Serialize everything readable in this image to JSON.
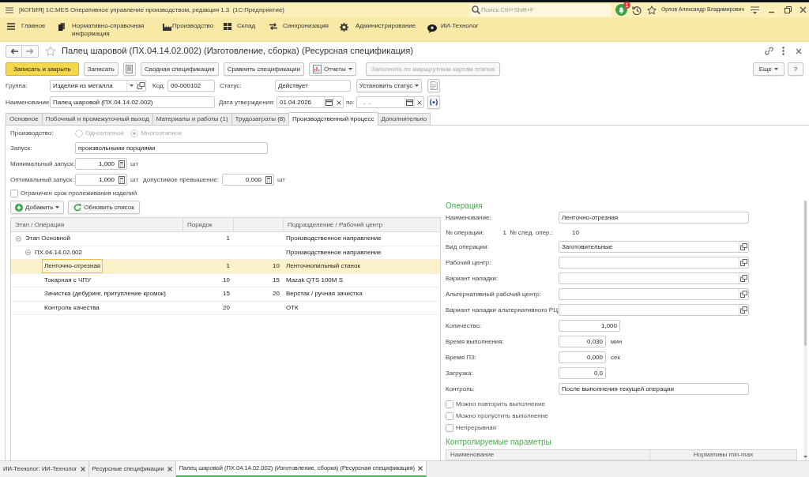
{
  "window": {
    "title": "[КОПИЯ] 1С:MES Оперативное управление производством, редакция 1.3  (1С:Предприятие)",
    "search": {
      "placeholder": "Поиск Ctrl+Shift+F"
    },
    "notifications": "1",
    "user": "Орлов Александр Владимирович"
  },
  "sections": [
    {
      "label": "Главное"
    },
    {
      "label": "Нормативно-справочная информация"
    },
    {
      "label": "Производство"
    },
    {
      "label": "Склад"
    },
    {
      "label": "Синхронизация"
    },
    {
      "label": "Администрирование"
    },
    {
      "label": "ИИ-Технолог"
    }
  ],
  "form": {
    "title": "Палец шаровой (ПХ.04.14.02.002) (Изготовление, сборка) (Ресурсная спецификация)",
    "favorite": false,
    "toolbar": [
      {
        "kind": "primary",
        "label": "Записать и закрыть",
        "disabled": false
      },
      {
        "kind": "button",
        "label": "Записать",
        "disabled": false
      },
      {
        "kind": "icon",
        "disabled": false
      },
      {
        "kind": "button",
        "label": "Сводная спецификация",
        "disabled": false
      },
      {
        "kind": "button",
        "label": "Сравнить спецификации",
        "disabled": false
      },
      {
        "kind": "menu",
        "label": "Отчеты",
        "disabled": false
      },
      {
        "kind": "button",
        "label": "Заполнить по маршрутным картам этапов",
        "disabled": true
      }
    ],
    "toolbar_right": [
      {
        "kind": "menu",
        "label": "Еще"
      },
      {
        "kind": "button",
        "label": "?"
      }
    ],
    "header": {
      "group": {
        "label": "Группа:",
        "value": "Изделия из металла"
      },
      "code": {
        "label": "Код:",
        "value": "00-000102"
      },
      "status": {
        "label": "Статус:",
        "value": "Действует"
      },
      "set_status_button": "Установить статус",
      "name": {
        "label": "Наименование:",
        "value": "Палец шаровой (ПХ.04.14.02.002)"
      },
      "approval_date": {
        "label": "Дата утверждения:",
        "value": "01.04.2026"
      },
      "date_to": {
        "label": "по:",
        "value": ".  ."
      }
    },
    "tabs": [
      {
        "label": "Основное",
        "selected": false
      },
      {
        "label": "Побочный и промежуточный выход",
        "selected": false
      },
      {
        "label": "Материалы и работы (1)",
        "selected": false
      },
      {
        "label": "Трудозатраты (8)",
        "selected": false
      },
      {
        "label": "Производственный процесс",
        "selected": true
      },
      {
        "label": "Дополнительно",
        "selected": false
      }
    ],
    "production": {
      "label": "Производство:",
      "disabled": true,
      "options": [
        {
          "label": "Одноэтапное",
          "selected": false
        },
        {
          "label": "Многоэтапное",
          "selected": true
        }
      ]
    },
    "launch": {
      "label": "Запуск:",
      "value": "произвольными порциями"
    },
    "min_launch": {
      "label": "Минимальный запуск:",
      "value": "1,000",
      "unit": "шт"
    },
    "optimal_launch": {
      "label": "Оптимальный запуск:",
      "value": "1,000",
      "unit": "шт"
    },
    "tolerance": {
      "label": "допустимое превышение:",
      "value": "0,000",
      "unit": "шт"
    },
    "shelf_life_limited": {
      "label": "Ограничен срок пролеживания изделий",
      "checked": false
    },
    "operations_toolbar": [
      {
        "kind": "add",
        "label": "Добавить"
      },
      {
        "kind": "refresh",
        "label": "Обновить список"
      }
    ],
    "operations_table": {
      "columns": {
        "stage": "Этап / Операция",
        "order": "Порядок",
        "work_center": "Подразделение / Рабочий центр"
      },
      "rows": [
        {
          "name": "Этап Основной",
          "order": "1",
          "work_center": "Производственное направление",
          "selected": false,
          "expanded": true,
          "children": [
            {
              "name": "ПХ.04.14.02.002",
              "work_center": "Производственное направление",
              "selected": false,
              "expanded": true,
              "children": [
                {
                  "name": "Ленточно-отрезная",
                  "order": "1",
                  "column_3": "10",
                  "work_center": "Ленточнопильный станок",
                  "selected": true
                },
                {
                  "name": "Токарная с ЧПУ",
                  "order": "10",
                  "column_3": "15",
                  "work_center": "Mazak QTS 100M S",
                  "selected": false
                },
                {
                  "name": "Зачистка (дебуринг, притупление кромок)",
                  "order": "15",
                  "column_3": "20",
                  "work_center": "Верстак / ручная зачистка",
                  "selected": false
                },
                {
                  "name": "Контроль качества",
                  "order": "20",
                  "work_center": "ОТК",
                  "selected": false
                }
              ]
            }
          ]
        }
      ]
    },
    "operation": {
      "title": "Операция",
      "fields": [
        {
          "kind": "text",
          "label": "Наименование:",
          "value": "Ленточно-отрезная"
        },
        {
          "kind": "pair",
          "label": "№ операции:",
          "value": "1",
          "label_2": "№ след. опер.:",
          "value_2": "10"
        },
        {
          "kind": "select",
          "label": "Вид операции:",
          "value": "Заготовительные"
        },
        {
          "kind": "select",
          "label": "Рабочий центр:"
        },
        {
          "kind": "select",
          "label": "Вариант наладки:"
        },
        {
          "kind": "select",
          "label": "Альтернативный рабочий центр:"
        },
        {
          "kind": "select",
          "label": "Вариант наладки альтернативного РЦ:"
        },
        {
          "kind": "number",
          "label": "Количество:",
          "value": "1,000"
        },
        {
          "kind": "number",
          "label": "Время выполнения:",
          "value": "0,030",
          "unit": "мин"
        },
        {
          "kind": "number",
          "label": "Время ПЗ:",
          "value": "0,000",
          "unit": "сек"
        },
        {
          "kind": "number",
          "label": "Загрузка:",
          "value": "0,0"
        },
        {
          "kind": "text",
          "label": "Контроль:",
          "value": "После выполнения текущей операции"
        }
      ],
      "flags": [
        {
          "label": "Можно повторить выполнение",
          "checked": false
        },
        {
          "label": "Можно пропустить выполнение",
          "checked": false
        },
        {
          "label": "Непрерывная",
          "checked": false
        }
      ],
      "params": {
        "title": "Контролируемые параметры",
        "columns": {
          "name": "Наименование",
          "norms": "Нормативы min-max"
        }
      }
    }
  },
  "open_windows": [
    {
      "label": "ИИ-Технолог: ИИ-Технолог",
      "selected": false
    },
    {
      "label": "Ресурсные спецификации",
      "selected": false
    },
    {
      "label": "Палец шаровой (ПХ.04.14.02.002) (Изготовление, сборка) (Ресурсная спецификация)",
      "selected": true
    }
  ]
}
